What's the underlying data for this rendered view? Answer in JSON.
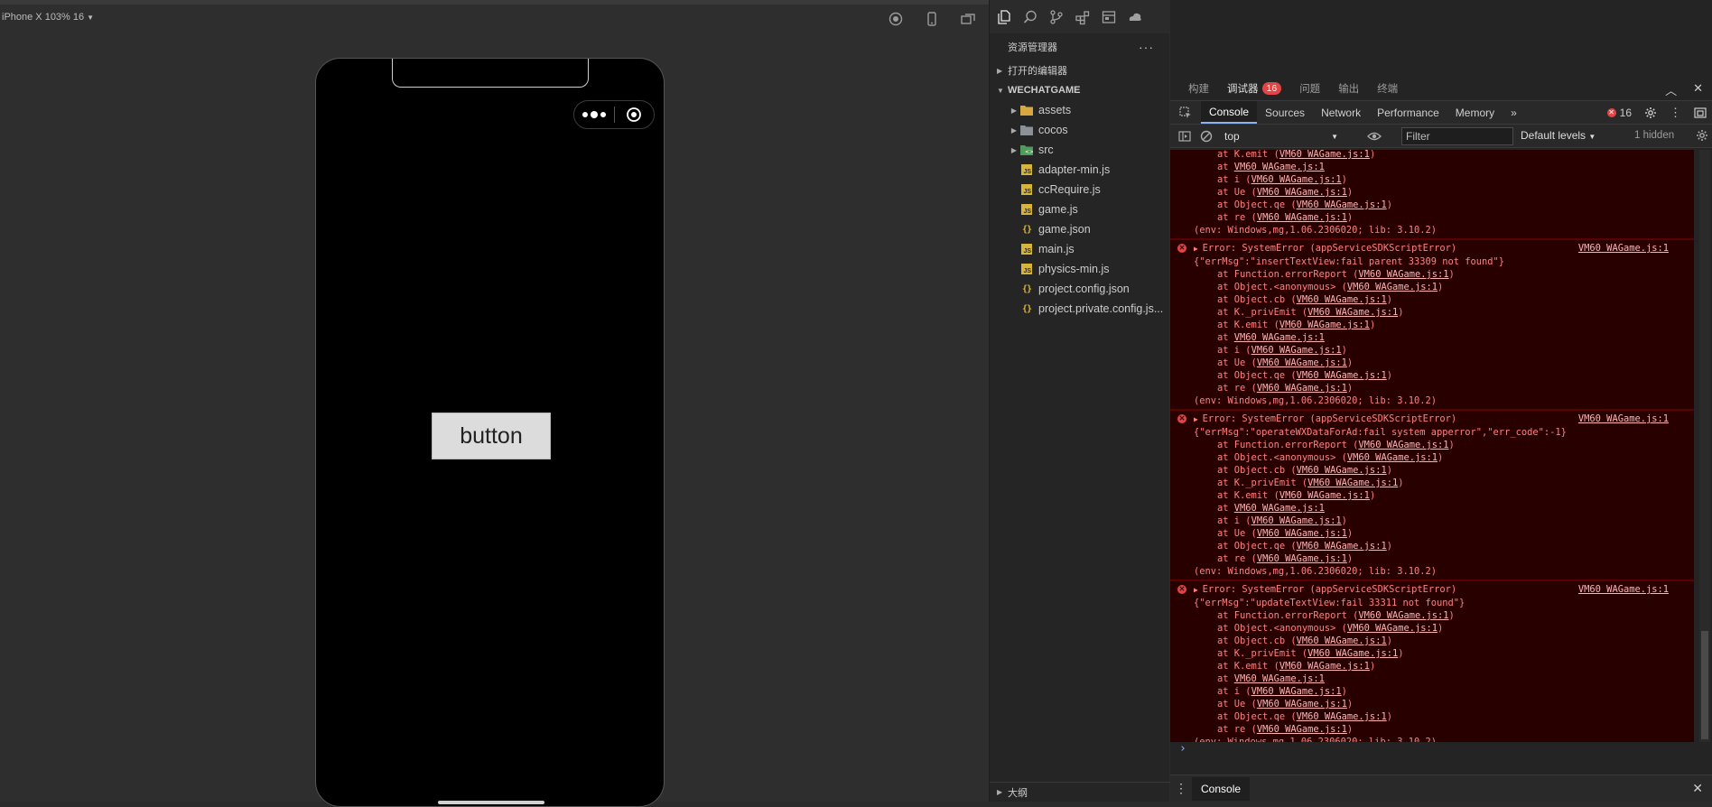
{
  "simulator": {
    "device_label": "iPhone X 103% 16",
    "game_button_label": "button"
  },
  "explorer": {
    "title": "资源管理器",
    "more_label": "···",
    "open_editors": "打开的编辑器",
    "project": "WECHATGAME",
    "folders": [
      "assets",
      "cocos",
      "src"
    ],
    "files": [
      {
        "name": "adapter-min.js",
        "type": "js"
      },
      {
        "name": "ccRequire.js",
        "type": "js"
      },
      {
        "name": "game.js",
        "type": "js"
      },
      {
        "name": "game.json",
        "type": "json"
      },
      {
        "name": "main.js",
        "type": "js"
      },
      {
        "name": "physics-min.js",
        "type": "js"
      },
      {
        "name": "project.config.json",
        "type": "json"
      },
      {
        "name": "project.private.config.js...",
        "type": "json"
      }
    ],
    "outline": "大纲"
  },
  "devtools": {
    "top_tabs": [
      "构建",
      "调试器",
      "问题",
      "输出",
      "终端"
    ],
    "debugger_badge": "16",
    "panel_tabs": [
      "Console",
      "Sources",
      "Network",
      "Performance",
      "Memory"
    ],
    "more_tabs": "»",
    "error_count": "16",
    "context": "top",
    "filter_placeholder": "Filter",
    "levels": "Default levels",
    "hidden": "1 hidden",
    "drawer_tab": "Console"
  },
  "console": {
    "source_link": "VM60 WAGame.js:1",
    "partial_tail": {
      "frames": [
        {
          "fn": "",
          "link": "VM60 WAGame.js:1"
        },
        {
          "fn": "i",
          "link": "VM60 WAGame.js:1"
        },
        {
          "fn": "Ue",
          "link": "VM60 WAGame.js:1"
        },
        {
          "fn": "Object.qe",
          "link": "VM60 WAGame.js:1"
        },
        {
          "fn": "re",
          "link": "VM60 WAGame.js:1"
        }
      ],
      "env": "(env: Windows,mg,1.06.2306020; lib: 3.10.2)"
    },
    "errors": [
      {
        "title": "Error: SystemError (appServiceSDKScriptError)",
        "detail": "{\"errMsg\":\"insertTextView:fail parent 33309 not found\"}",
        "env": "(env: Windows,mg,1.06.2306020; lib: 3.10.2)"
      },
      {
        "title": "Error: SystemError (appServiceSDKScriptError)",
        "detail": "{\"errMsg\":\"operateWXDataForAd:fail system apperror\",\"err_code\":-1}",
        "env": "(env: Windows,mg,1.06.2306020; lib: 3.10.2)"
      },
      {
        "title": "Error: SystemError (appServiceSDKScriptError)",
        "detail": "{\"errMsg\":\"updateTextView:fail 33311 not found\"}",
        "env": "(env: Windows,mg,1.06.2306020; lib: 3.10.2)"
      }
    ],
    "stack": [
      {
        "fn": "Function.errorReport",
        "link": "VM60 WAGame.js:1"
      },
      {
        "fn": "Object.<anonymous>",
        "link": "VM60 WAGame.js:1"
      },
      {
        "fn": "Object.cb",
        "link": "VM60 WAGame.js:1"
      },
      {
        "fn": "K._privEmit",
        "link": "VM60 WAGame.js:1"
      },
      {
        "fn": "K.emit",
        "link": "VM60 WAGame.js:1"
      },
      {
        "fn": "",
        "link": "VM60 WAGame.js:1"
      },
      {
        "fn": "i",
        "link": "VM60 WAGame.js:1"
      },
      {
        "fn": "Ue",
        "link": "VM60 WAGame.js:1"
      },
      {
        "fn": "Object.qe",
        "link": "VM60 WAGame.js:1"
      },
      {
        "fn": "re",
        "link": "VM60 WAGame.js:1"
      }
    ],
    "prompt": "›"
  },
  "colors": {
    "error_text": "#ff8080",
    "error_bg": "#290000",
    "accent": "#8ab4f8",
    "badge": "#e14545",
    "js_icon": "#d7b53c"
  }
}
